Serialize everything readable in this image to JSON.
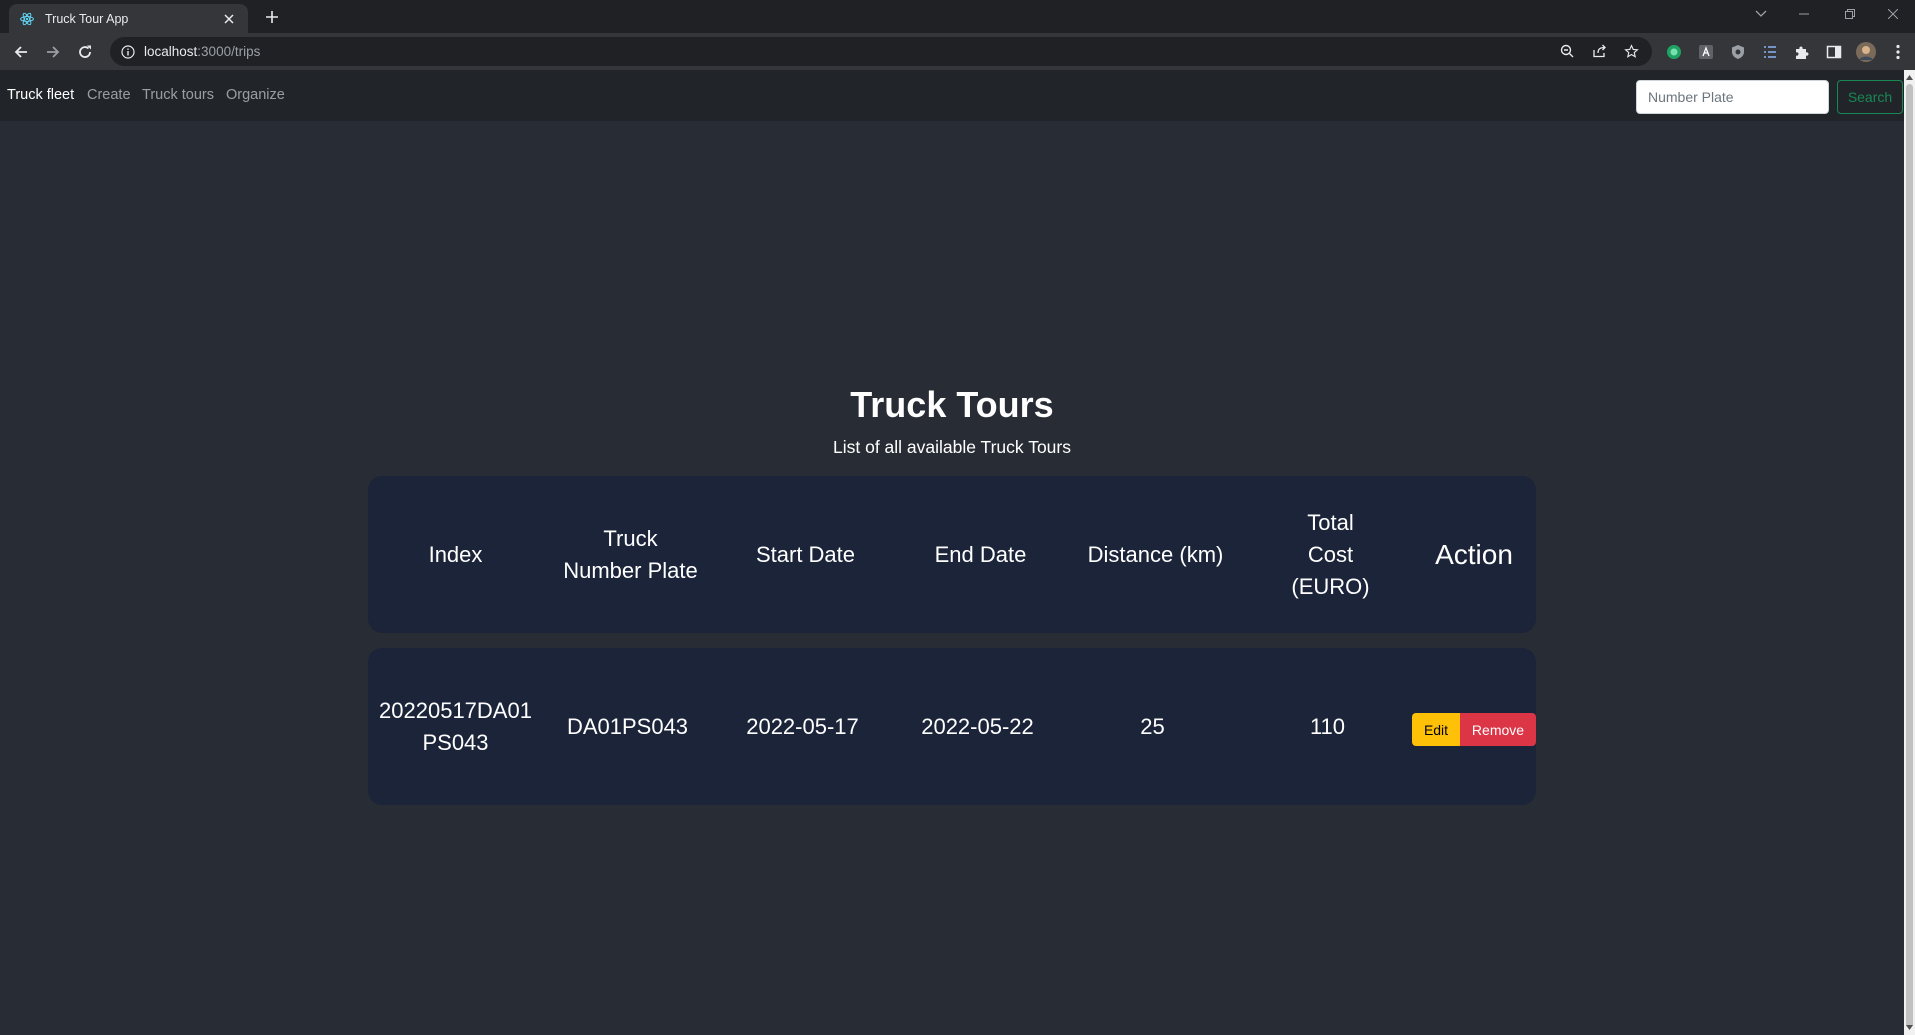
{
  "browser": {
    "tab_title": "Truck Tour App",
    "url_host": "localhost",
    "url_path": ":3000/trips"
  },
  "navbar": {
    "brand": "Truck fleet",
    "links": [
      "Create",
      "Truck tours",
      "Organize"
    ],
    "search_placeholder": "Number Plate",
    "search_button": "Search"
  },
  "page": {
    "title": "Truck Tours",
    "subtitle": "List of all available Truck Tours"
  },
  "table": {
    "columns": [
      "Index",
      "Truck Number Plate",
      "Start Date",
      "End Date",
      "Distance (km)",
      "Total Cost (EURO)",
      "Action"
    ],
    "rows": [
      {
        "index": "20220517DA01PS043",
        "plate": "DA01PS043",
        "start_date": "2022-05-17",
        "end_date": "2022-05-22",
        "distance": "25",
        "total_cost": "110",
        "edit_label": "Edit",
        "remove_label": "Remove"
      }
    ]
  },
  "colors": {
    "page_bg": "#282c34",
    "card_bg": "#1b2438",
    "navbar_bg": "#212529",
    "edit": "#ffc107",
    "remove": "#dc3545",
    "search_outline": "#198754"
  },
  "icons": [
    "react-favicon-icon",
    "close-icon",
    "plus-icon",
    "back-icon",
    "forward-icon",
    "reload-icon",
    "info-icon",
    "zoom-icon",
    "share-icon",
    "star-icon",
    "puzzle-icon",
    "sidepanel-icon",
    "profile-avatar",
    "menu-dots-icon"
  ]
}
